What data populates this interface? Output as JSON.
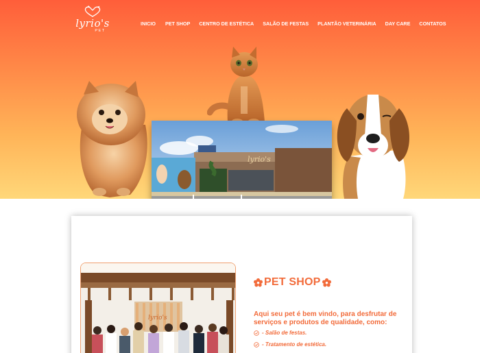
{
  "brand": {
    "logo_script": "lyrio's",
    "logo_sub": "PET"
  },
  "nav": {
    "items": [
      {
        "label": "INICIO",
        "name": "nav-item-inicio"
      },
      {
        "label": "PET SHOP",
        "name": "nav-item-pet-shop"
      },
      {
        "label": "CENTRO DE ESTÉTICA",
        "name": "nav-item-centro-de-estetica"
      },
      {
        "label": "SALÃO DE FESTAS",
        "name": "nav-item-salao-de-festas"
      },
      {
        "label": "PLANTÃO VETERINÁRIA",
        "name": "nav-item-plantao-veterinaria"
      },
      {
        "label": "DAY CARE",
        "name": "nav-item-day-care"
      },
      {
        "label": "CONTATOS",
        "name": "nav-item-contatos"
      }
    ]
  },
  "store_sign": "lyrio's",
  "section": {
    "title": "PET SHOP",
    "intro": "Aqui seu pet é bem vindo, para desfrutar de serviços e produtos de qualidade, como:",
    "services": [
      "- Salão de festas.",
      "- Tratamento de estética."
    ]
  },
  "colors": {
    "accent": "#f26b3a",
    "hero_top": "#ff5e3a",
    "hero_bottom": "#ffd779"
  },
  "icons": {
    "logo": "cat-dog-heart-icon",
    "title_flower": "hibiscus-icon",
    "service_check": "check-circle-icon"
  }
}
